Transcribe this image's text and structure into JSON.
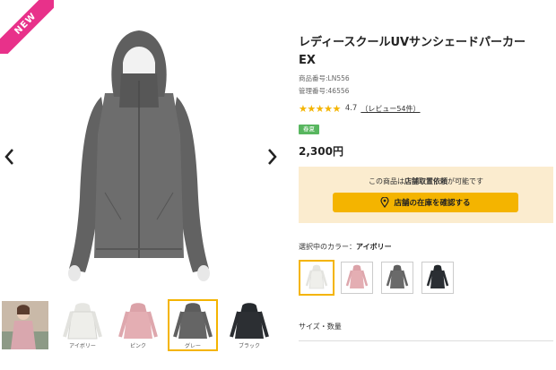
{
  "gallery": {
    "badge": "NEW",
    "thumbnails": [
      {
        "caption": "",
        "color": "#d9a7ae"
      },
      {
        "caption": "アイボリー",
        "color": "#eeeeea"
      },
      {
        "caption": "ピンク",
        "color": "#e4aeb3"
      },
      {
        "caption": "グレー",
        "color": "#656565"
      },
      {
        "caption": "ブラック",
        "color": "#2c2f33"
      }
    ],
    "selected_thumbnail": 3
  },
  "product": {
    "title": "レディースクールUVサンシェードパーカーEX",
    "product_number": "商品番号:LN556",
    "management_number": "管理番号:46556",
    "rating": 4.7,
    "rating_text": "4.7",
    "review_link": "（レビュー54件）",
    "badge": "春夏",
    "price": "2,300円"
  },
  "store": {
    "note_prefix": "この商品は",
    "note_bold": "店舗取置依頼",
    "note_suffix": "が可能です",
    "button_label": "店舗の在庫を確認する"
  },
  "color": {
    "label": "選択中のカラー：",
    "selected_name": "アイボリー",
    "swatches": [
      {
        "name": "アイボリー",
        "color": "#efefeb"
      },
      {
        "name": "ピンク",
        "color": "#e4aeb3"
      },
      {
        "name": "グレー",
        "color": "#6a6a6a"
      },
      {
        "name": "ブラック",
        "color": "#2a2e33"
      }
    ],
    "selected_index": 0
  },
  "size": {
    "label": "サイズ・数量"
  },
  "colors": {
    "accent": "#f4b400",
    "new_badge": "#e8318a",
    "season_badge": "#58b65f",
    "store_box_bg": "#fbeccf"
  }
}
